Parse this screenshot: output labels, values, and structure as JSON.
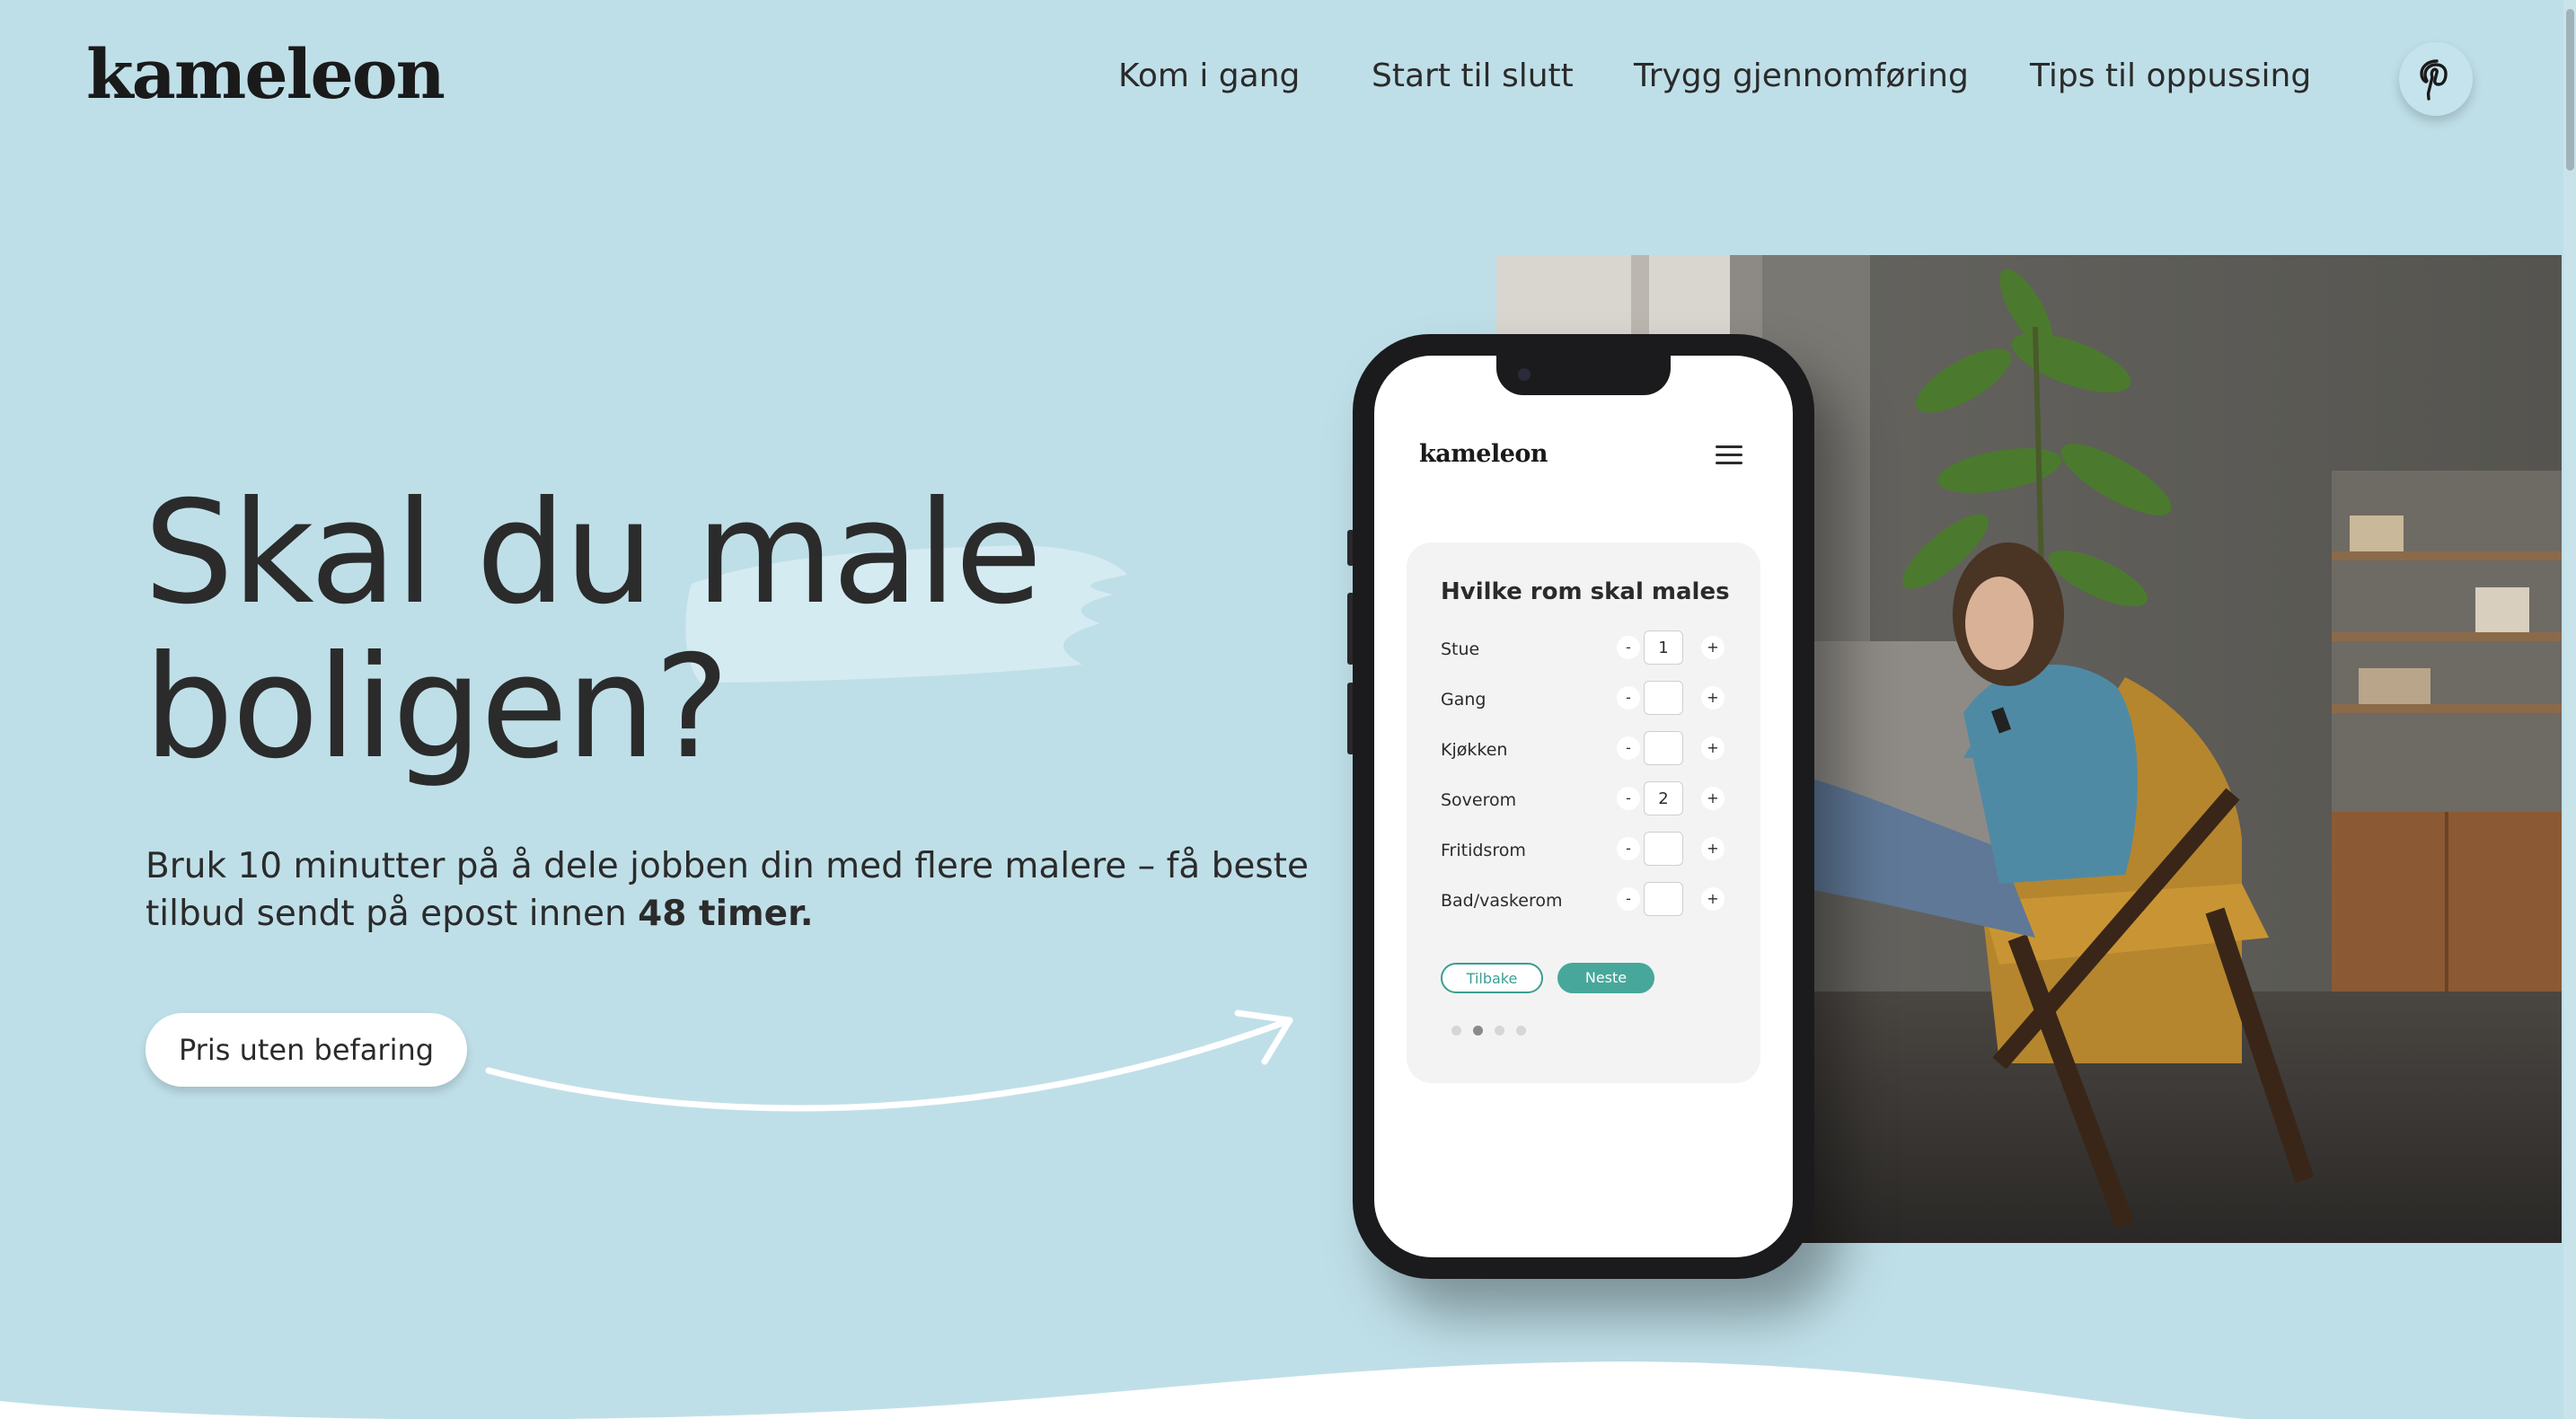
{
  "header": {
    "logo": "kameleon",
    "nav": [
      "Kom i gang",
      "Start til slutt",
      "Trygg gjennomføring",
      "Tips til oppussing"
    ],
    "social_icon": "pinterest-icon"
  },
  "hero": {
    "headline_line1": "Skal du male",
    "headline_line2": "boligen?",
    "subtext_line1": "Bruk 10 minutter på å dele jobben din med flere malere – få beste",
    "subtext_line2": "tilbud sendt på epost innen",
    "subtext_bold": "48 timer.",
    "cta_label": "Pris uten befaring"
  },
  "phone": {
    "app_logo": "kameleon",
    "menu_icon": "hamburger-menu-icon",
    "card_title": "Hvilke rom skal males",
    "rooms": [
      {
        "label": "Stue",
        "value": "1"
      },
      {
        "label": "Gang",
        "value": ""
      },
      {
        "label": "Kjøkken",
        "value": ""
      },
      {
        "label": "Soverom",
        "value": "2"
      },
      {
        "label": "Fritidsrom",
        "value": ""
      },
      {
        "label": "Bad/vaskerom",
        "value": ""
      }
    ],
    "minus_label": "-",
    "plus_label": "+",
    "back_label": "Tilbake",
    "next_label": "Neste",
    "steps_total": 4,
    "active_step": 2
  },
  "colors": {
    "background": "#bfdfe8",
    "accent": "#47a79b",
    "text": "#2b2b2b"
  }
}
